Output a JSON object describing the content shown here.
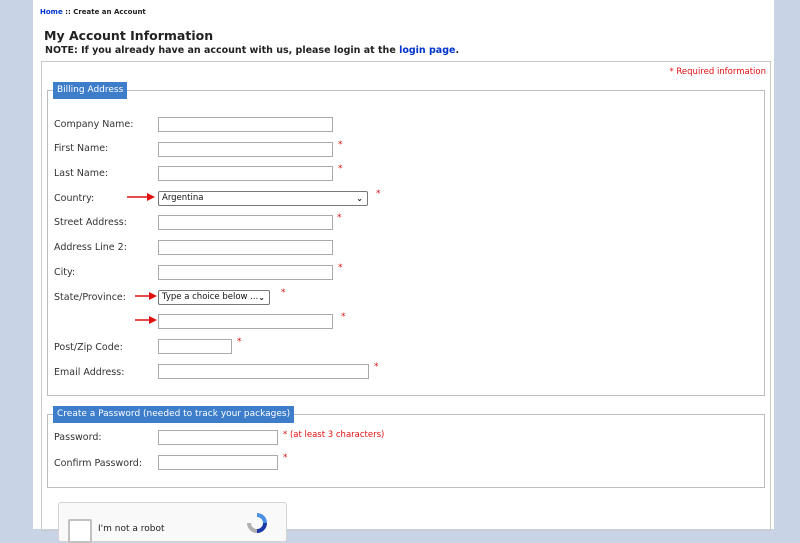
{
  "breadcrumb": {
    "home": "Home",
    "sep": " :: ",
    "current": "Create an Account"
  },
  "title": "My Account Information",
  "note": {
    "prefix": "NOTE: If you already have an account with us, please login at the ",
    "link": "login page",
    "suffix": "."
  },
  "required_info": "* Required information",
  "required_marker": "*",
  "billing": {
    "legend": "Billing Address",
    "company_label": "Company Name:",
    "first_label": "First Name:",
    "last_label": "Last Name:",
    "country_label": "Country:",
    "country_value": "Argentina",
    "street_label": "Street Address:",
    "address2_label": "Address Line 2:",
    "city_label": "City:",
    "state_label": "State/Province:",
    "state_value": "Type a choice below ...",
    "zip_label": "Post/Zip Code:",
    "email_label": "Email Address:"
  },
  "password": {
    "legend": "Create a Password (needed to track your packages)",
    "password_label": "Password:",
    "password_hint": "* (at least 3 characters)",
    "confirm_label": "Confirm Password:"
  },
  "captcha": {
    "label": "I'm not a robot"
  },
  "colors": {
    "accent": "#3d7dca",
    "required": "#e01010",
    "link": "#0033cc",
    "backdrop": "#c9d3e6"
  },
  "icons": {
    "arrow": "red-arrow-icon",
    "chevron": "chevron-down-icon",
    "captcha_logo": "recaptcha-icon"
  }
}
